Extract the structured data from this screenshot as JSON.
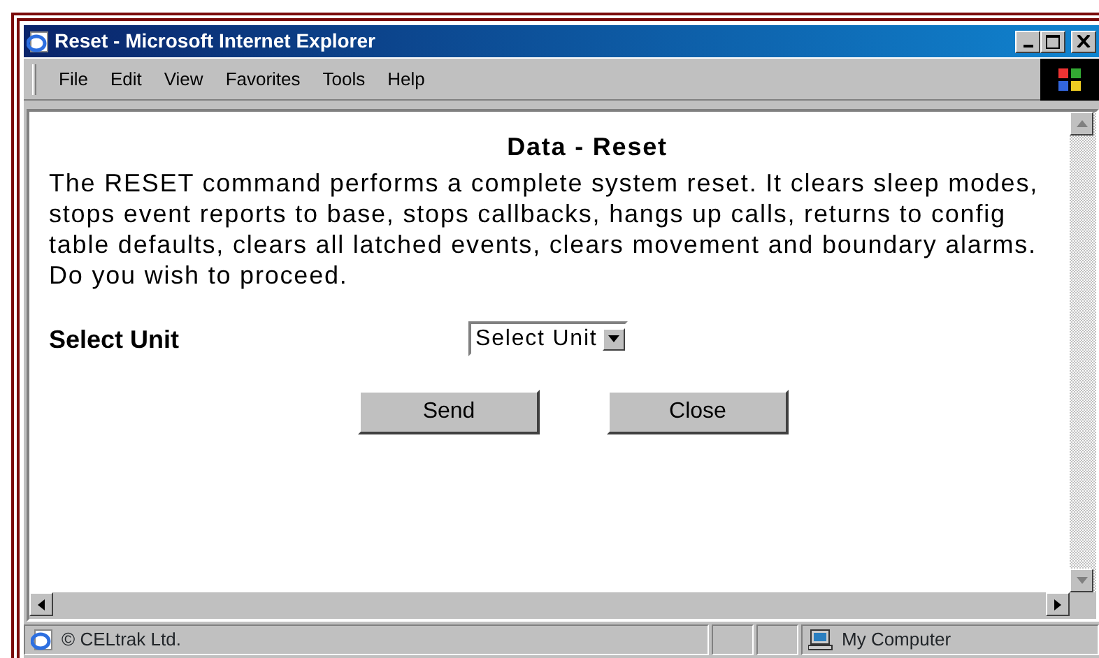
{
  "window": {
    "title": "Reset - Microsoft Internet Explorer"
  },
  "menu": [
    {
      "label": "File"
    },
    {
      "label": "Edit"
    },
    {
      "label": "View"
    },
    {
      "label": "Favorites"
    },
    {
      "label": "Tools"
    },
    {
      "label": "Help"
    }
  ],
  "page": {
    "heading": "Data - Reset",
    "message": "The RESET command performs a complete system reset. It clears sleep modes, stops event reports to base, stops callbacks, hangs up calls, returns to config table defaults, clears all latched events, clears movement and boundary alarms. Do you wish to proceed.",
    "unit_label": "Select Unit",
    "unit_select": {
      "value": "Select Unit"
    },
    "buttons": [
      "Send",
      "Close"
    ]
  },
  "status_bar": {
    "text": "© CELtrak Ltd.",
    "zone": "My Computer"
  }
}
